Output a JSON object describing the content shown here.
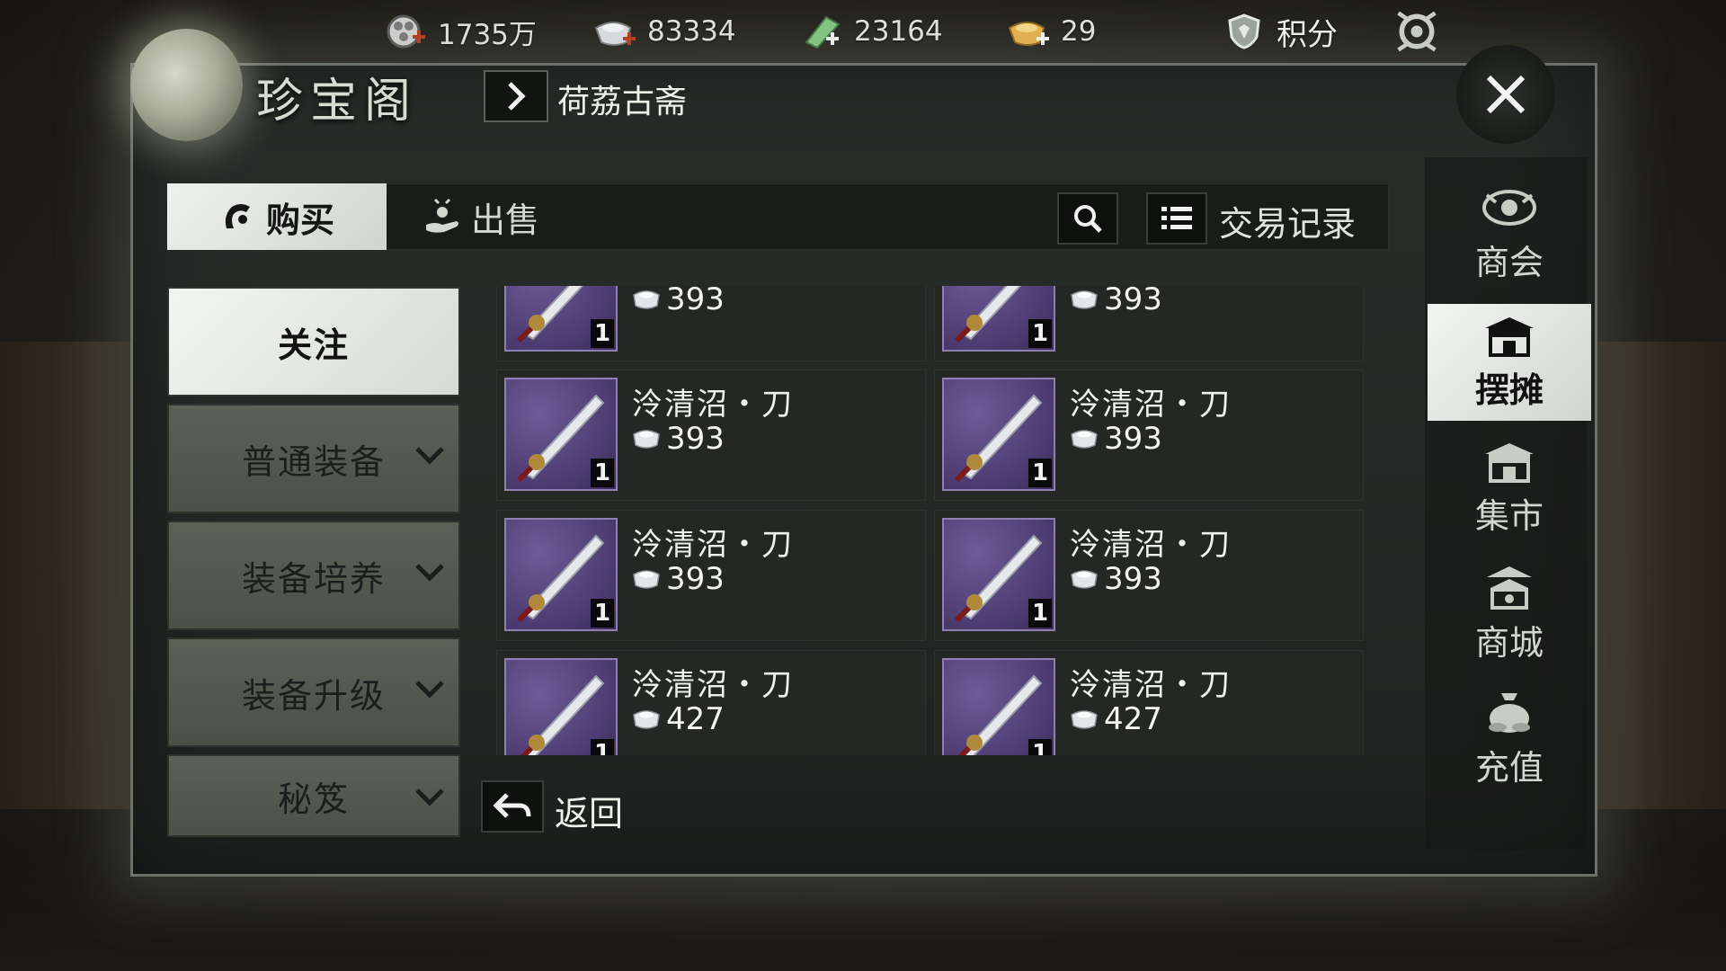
{
  "currencies": [
    {
      "icon": "coin-bundle-icon",
      "value": "1735万"
    },
    {
      "icon": "silver-ingot-plus-icon",
      "value": "83334"
    },
    {
      "icon": "jade-plus-icon",
      "value": "23164"
    },
    {
      "icon": "gold-ingot-plus-icon",
      "value": "29"
    }
  ],
  "points_label": "积分",
  "window": {
    "title": "珍宝阁",
    "breadcrumb": "荷荔古斋"
  },
  "tabs": {
    "buy": "购买",
    "sell": "出售",
    "record": "交易记录"
  },
  "categories": [
    {
      "label": "关注",
      "active": true,
      "expandable": false
    },
    {
      "label": "普通装备",
      "active": false,
      "expandable": true
    },
    {
      "label": "装备培养",
      "active": false,
      "expandable": true
    },
    {
      "label": "装备升级",
      "active": false,
      "expandable": true
    },
    {
      "label": "秘笈",
      "active": false,
      "expandable": true
    }
  ],
  "items": [
    {
      "name": "",
      "price": "393",
      "qty": "1"
    },
    {
      "name": "",
      "price": "393",
      "qty": "1"
    },
    {
      "name": "泠清沼・刀",
      "price": "393",
      "qty": "1"
    },
    {
      "name": "泠清沼・刀",
      "price": "393",
      "qty": "1"
    },
    {
      "name": "泠清沼・刀",
      "price": "393",
      "qty": "1"
    },
    {
      "name": "泠清沼・刀",
      "price": "393",
      "qty": "1"
    },
    {
      "name": "泠清沼・刀",
      "price": "427",
      "qty": "1"
    },
    {
      "name": "泠清沼・刀",
      "price": "427",
      "qty": "1"
    }
  ],
  "back_label": "返回",
  "side_nav": [
    {
      "label": "商会",
      "icon": "guild-emblem-icon",
      "active": false
    },
    {
      "label": "摆摊",
      "icon": "stall-icon",
      "active": true
    },
    {
      "label": "集市",
      "icon": "market-icon",
      "active": false
    },
    {
      "label": "商城",
      "icon": "mall-pagoda-icon",
      "active": false
    },
    {
      "label": "充值",
      "icon": "money-bag-icon",
      "active": false
    }
  ],
  "colors": {
    "active_tab": "#eef0ec",
    "item_frame": "#5a4785",
    "panel": "#242724"
  }
}
